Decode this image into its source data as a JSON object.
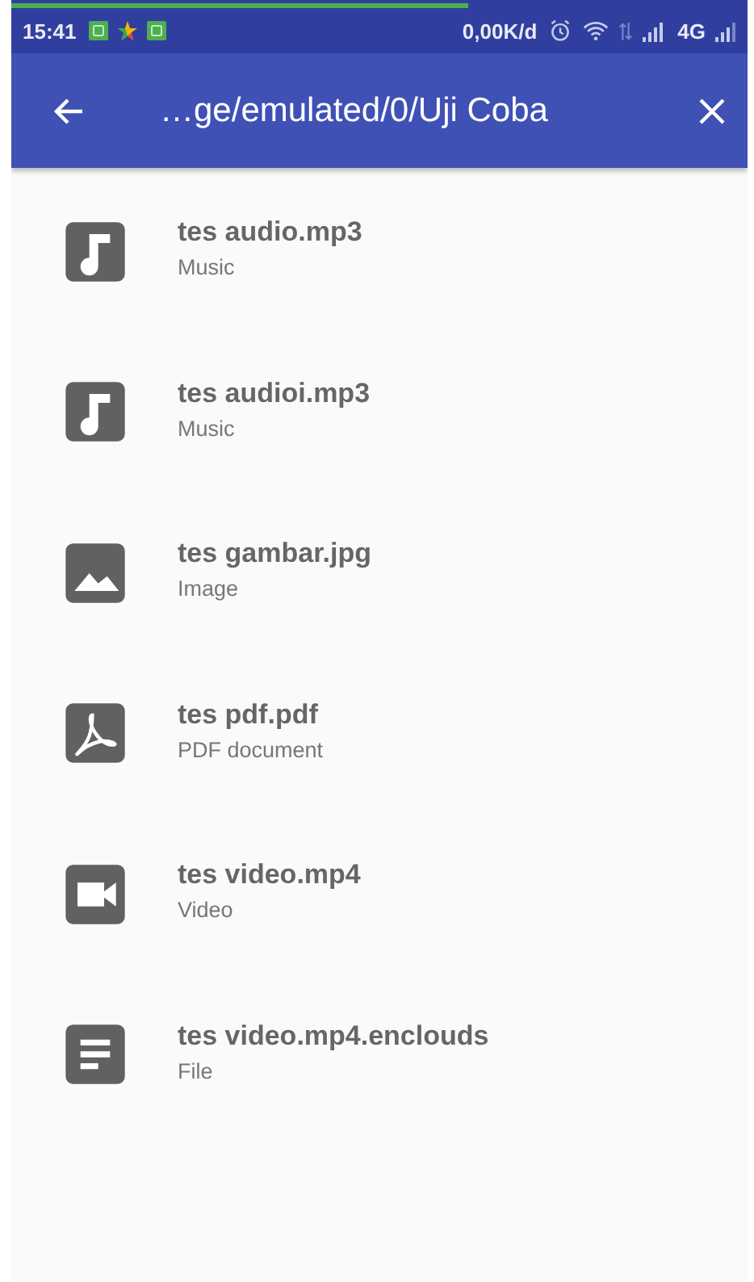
{
  "status_bar": {
    "time": "15:41",
    "speed": "0,00K/d",
    "network": "4G"
  },
  "progress": {
    "level": 0.62
  },
  "app_bar": {
    "title": "…ge/emulated/0/Uji Coba"
  },
  "files": [
    {
      "kind": "music",
      "name": "tes audio.mp3",
      "type": "Music"
    },
    {
      "kind": "music",
      "name": "tes audioi.mp3",
      "type": "Music"
    },
    {
      "kind": "image",
      "name": "tes gambar.jpg",
      "type": "Image"
    },
    {
      "kind": "pdf",
      "name": "tes pdf.pdf",
      "type": "PDF document"
    },
    {
      "kind": "video",
      "name": "tes video.mp4",
      "type": "Video"
    },
    {
      "kind": "file",
      "name": "tes video.mp4.enclouds",
      "type": "File"
    }
  ]
}
